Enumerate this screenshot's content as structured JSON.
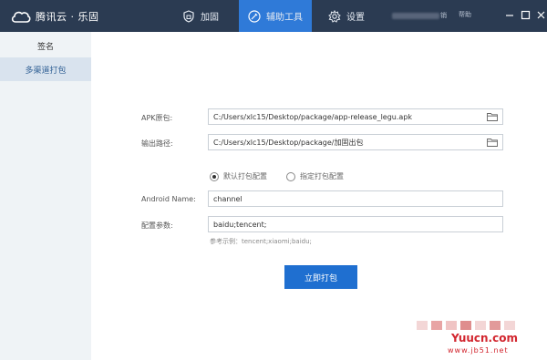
{
  "app": {
    "brand": "腾讯云 · 乐固"
  },
  "nav": {
    "tabs": [
      {
        "label": "加固",
        "icon": "shield-icon"
      },
      {
        "label": "辅助工具",
        "icon": "tool-icon",
        "active": true
      },
      {
        "label": "设置",
        "icon": "gear-icon"
      }
    ],
    "account_suffix": "销",
    "help": "帮助"
  },
  "sidebar": {
    "items": [
      {
        "label": "签名"
      },
      {
        "label": "多渠道打包",
        "active": true
      }
    ]
  },
  "form": {
    "apk_label": "APK原包:",
    "apk_value": "C:/Users/xlc15/Desktop/package/app-release_legu.apk",
    "output_label": "输出路径:",
    "output_value": "C:/Users/xlc15/Desktop/package/加固出包",
    "radio_default": "默认打包配置",
    "radio_custom": "指定打包配置",
    "android_name_label": "Android Name:",
    "android_name_value": "channel",
    "params_label": "配置参数:",
    "params_value": "baidu;tencent;",
    "hint": "参考示例：tencent;xiaomi;baidu;",
    "pack_button": "立即打包"
  },
  "watermark": {
    "text": "Yuucn.com",
    "url": "www.jb51.net"
  },
  "colors": {
    "titlebar": "#2b3b52",
    "active_tab": "#2f7ad8",
    "button": "#1f6fd0",
    "sidebar": "#eff3f6",
    "sidebar_active": "#d9e3ee"
  }
}
